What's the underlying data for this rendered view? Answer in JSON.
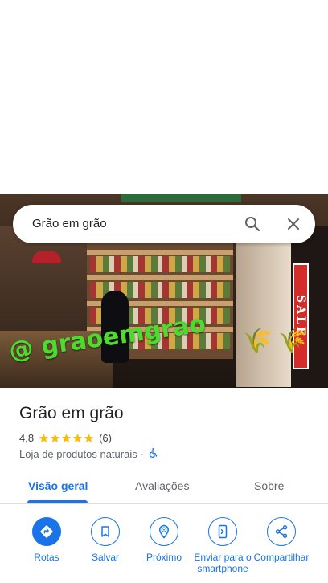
{
  "search": {
    "query": "Grão em grão"
  },
  "photo": {
    "watermark": "@ graoemgrao",
    "sign": "SALE"
  },
  "place": {
    "name": "Grão em grão",
    "rating": "4,8",
    "review_count": "(6)",
    "stars": 5,
    "category": "Loja de produtos naturais",
    "separator": "·"
  },
  "tabs": [
    {
      "label": "Visão geral"
    },
    {
      "label": "Avaliações"
    },
    {
      "label": "Sobre"
    }
  ],
  "actions": [
    {
      "label": "Rotas",
      "icon": "directions-icon"
    },
    {
      "label": "Salvar",
      "icon": "bookmark-icon"
    },
    {
      "label": "Próximo",
      "icon": "nearby-icon"
    },
    {
      "label": "Enviar para o smartphone",
      "icon": "send-to-phone-icon"
    },
    {
      "label": "Compartilhar",
      "icon": "share-icon"
    }
  ],
  "colors": {
    "accent": "#1a73e8",
    "star": "#fbbc04",
    "watermark": "#4ddb2e"
  }
}
